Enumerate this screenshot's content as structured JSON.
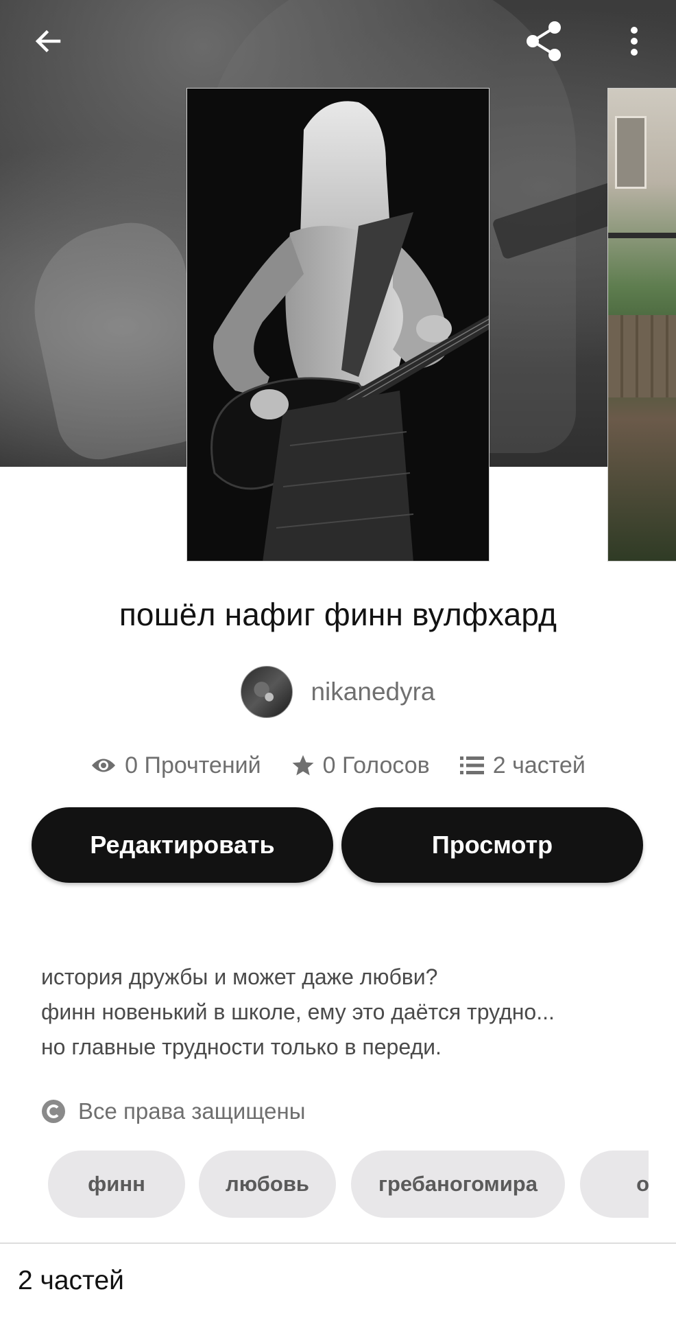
{
  "story": {
    "title": "пошёл нафиг финн вулфхард",
    "author": "nikanedyra",
    "stats": {
      "reads": "0 Прочтений",
      "votes": "0 Голосов",
      "parts": "2 частей"
    },
    "description_lines": [
      "история дружбы и может даже любви?",
      "финн новенький в школе, ему это даётся трудно...",
      "но главные трудности только в переди."
    ],
    "copyright": "Все права защищены",
    "tags": [
      "финн",
      "любовь",
      "гребаногомира",
      "ос"
    ]
  },
  "actions": {
    "edit_label": "Редактировать",
    "view_label": "Просмотр"
  },
  "parts_section": {
    "heading": "2 частей"
  },
  "icons": {
    "back": "arrow-left-icon",
    "share": "share-icon",
    "more": "more-vertical-icon",
    "reads": "eye-icon",
    "votes": "star-icon",
    "parts": "list-icon",
    "copyright": "copyright-icon"
  },
  "colors": {
    "primary_button": "#121212",
    "tag_background": "#e8e7e9",
    "muted_text": "#6f6f6f"
  }
}
